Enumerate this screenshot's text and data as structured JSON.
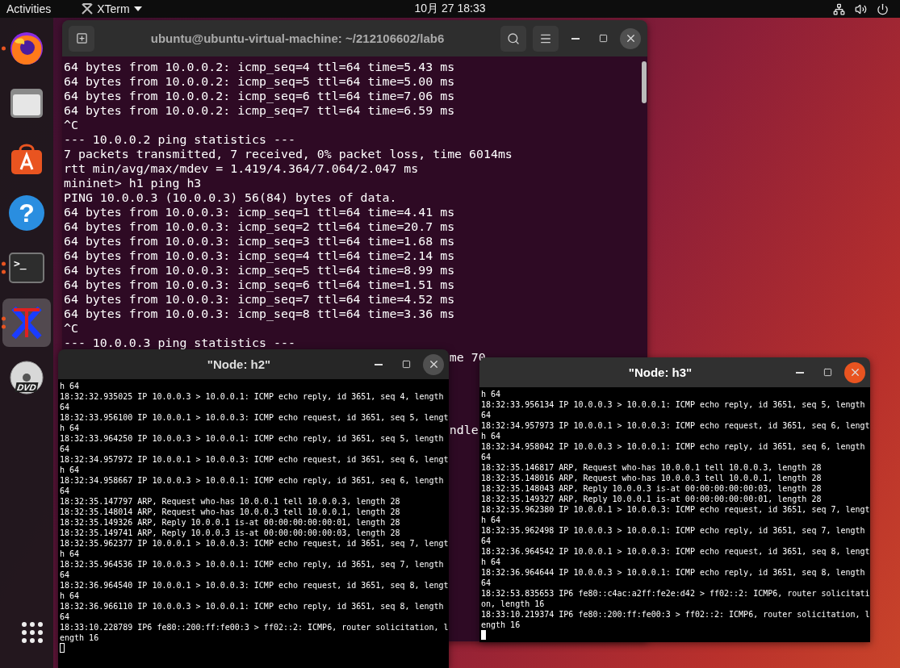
{
  "top_bar": {
    "activities": "Activities",
    "app_name": "XTerm",
    "clock": "10月 27  18:33"
  },
  "dock": {
    "items": [
      {
        "kind": "firefox",
        "running": true,
        "multiple_windows": false,
        "selected": false
      },
      {
        "kind": "files",
        "running": false,
        "selected": false
      },
      {
        "kind": "software",
        "running": false,
        "selected": false
      },
      {
        "kind": "help",
        "glyph": "?",
        "running": false,
        "selected": false
      },
      {
        "kind": "terminal",
        "glyph": ">_",
        "running": true,
        "multiple_windows": true,
        "selected": false
      },
      {
        "kind": "xterm",
        "running": true,
        "multiple_windows": true,
        "selected": true
      },
      {
        "kind": "dvd",
        "glyph": "DVD",
        "running": false,
        "selected": false
      }
    ],
    "apps_button": {
      "kind": "apps"
    }
  },
  "terminal": {
    "title": "ubuntu@ubuntu-virtual-machine: ~/212106602/lab6",
    "lines": [
      "64 bytes from 10.0.0.2: icmp_seq=4 ttl=64 time=5.43 ms",
      "64 bytes from 10.0.0.2: icmp_seq=5 ttl=64 time=5.00 ms",
      "64 bytes from 10.0.0.2: icmp_seq=6 ttl=64 time=7.06 ms",
      "64 bytes from 10.0.0.2: icmp_seq=7 ttl=64 time=6.59 ms",
      "^C",
      "--- 10.0.0.2 ping statistics ---",
      "7 packets transmitted, 7 received, 0% packet loss, time 6014ms",
      "rtt min/avg/max/mdev = 1.419/4.364/7.064/2.047 ms",
      "mininet> h1 ping h3",
      "PING 10.0.0.3 (10.0.0.3) 56(84) bytes of data.",
      "64 bytes from 10.0.0.3: icmp_seq=1 ttl=64 time=4.41 ms",
      "64 bytes from 10.0.0.3: icmp_seq=2 ttl=64 time=20.7 ms",
      "64 bytes from 10.0.0.3: icmp_seq=3 ttl=64 time=1.68 ms",
      "64 bytes from 10.0.0.3: icmp_seq=4 ttl=64 time=2.14 ms",
      "64 bytes from 10.0.0.3: icmp_seq=5 ttl=64 time=8.99 ms",
      "64 bytes from 10.0.0.3: icmp_seq=6 ttl=64 time=1.51 ms",
      "64 bytes from 10.0.0.3: icmp_seq=7 ttl=64 time=4.52 ms",
      "64 bytes from 10.0.0.3: icmp_seq=8 ttl=64 time=3.36 ms",
      "^C",
      "--- 10.0.0.3 ping statistics ---"
    ],
    "hidden_fragments": [
      "me 70",
      "ndle"
    ]
  },
  "xterms": [
    {
      "title": "\"Node: h2\"",
      "focused": false,
      "lines": [
        "h 64",
        "18:32:32.935025 IP 10.0.0.3 > 10.0.0.1: ICMP echo reply, id 3651, seq 4, length",
        "64",
        "18:32:33.956100 IP 10.0.0.1 > 10.0.0.3: ICMP echo request, id 3651, seq 5, lengt",
        "h 64",
        "18:32:33.964250 IP 10.0.0.3 > 10.0.0.1: ICMP echo reply, id 3651, seq 5, length",
        "64",
        "18:32:34.957972 IP 10.0.0.1 > 10.0.0.3: ICMP echo request, id 3651, seq 6, lengt",
        "h 64",
        "18:32:34.958667 IP 10.0.0.3 > 10.0.0.1: ICMP echo reply, id 3651, seq 6, length",
        "64",
        "18:32:35.147797 ARP, Request who-has 10.0.0.1 tell 10.0.0.3, length 28",
        "18:32:35.148014 ARP, Request who-has 10.0.0.3 tell 10.0.0.1, length 28",
        "18:32:35.149326 ARP, Reply 10.0.0.1 is-at 00:00:00:00:00:01, length 28",
        "18:32:35.149741 ARP, Reply 10.0.0.3 is-at 00:00:00:00:00:03, length 28",
        "18:32:35.962377 IP 10.0.0.1 > 10.0.0.3: ICMP echo request, id 3651, seq 7, lengt",
        "h 64",
        "18:32:35.964536 IP 10.0.0.3 > 10.0.0.1: ICMP echo reply, id 3651, seq 7, length",
        "64",
        "18:32:36.964540 IP 10.0.0.1 > 10.0.0.3: ICMP echo request, id 3651, seq 8, lengt",
        "h 64",
        "18:32:36.966110 IP 10.0.0.3 > 10.0.0.1: ICMP echo reply, id 3651, seq 8, length",
        "64",
        "18:33:10.228789 IP6 fe80::200:ff:fe00:3 > ff02::2: ICMP6, router solicitation, l",
        "ength 16"
      ]
    },
    {
      "title": "\"Node: h3\"",
      "focused": true,
      "lines": [
        "h 64",
        "18:32:33.956134 IP 10.0.0.3 > 10.0.0.1: ICMP echo reply, id 3651, seq 5, length",
        "64",
        "18:32:34.957973 IP 10.0.0.1 > 10.0.0.3: ICMP echo request, id 3651, seq 6, lengt",
        "h 64",
        "18:32:34.958042 IP 10.0.0.3 > 10.0.0.1: ICMP echo reply, id 3651, seq 6, length",
        "64",
        "18:32:35.146817 ARP, Request who-has 10.0.0.1 tell 10.0.0.3, length 28",
        "18:32:35.148016 ARP, Request who-has 10.0.0.3 tell 10.0.0.1, length 28",
        "18:32:35.148043 ARP, Reply 10.0.0.3 is-at 00:00:00:00:00:03, length 28",
        "18:32:35.149327 ARP, Reply 10.0.0.1 is-at 00:00:00:00:00:01, length 28",
        "18:32:35.962380 IP 10.0.0.1 > 10.0.0.3: ICMP echo request, id 3651, seq 7, lengt",
        "h 64",
        "18:32:35.962498 IP 10.0.0.3 > 10.0.0.1: ICMP echo reply, id 3651, seq 7, length",
        "64",
        "18:32:36.964542 IP 10.0.0.1 > 10.0.0.3: ICMP echo request, id 3651, seq 8, lengt",
        "h 64",
        "18:32:36.964644 IP 10.0.0.3 > 10.0.0.1: ICMP echo reply, id 3651, seq 8, length",
        "64",
        "18:32:53.835653 IP6 fe80::c4ac:a2ff:fe2e:d42 > ff02::2: ICMP6, router solicitati",
        "on, length 16",
        "18:33:10.219374 IP6 fe80::200:ff:fe00:3 > ff02::2: ICMP6, router solicitation, l",
        "ength 16"
      ]
    }
  ]
}
